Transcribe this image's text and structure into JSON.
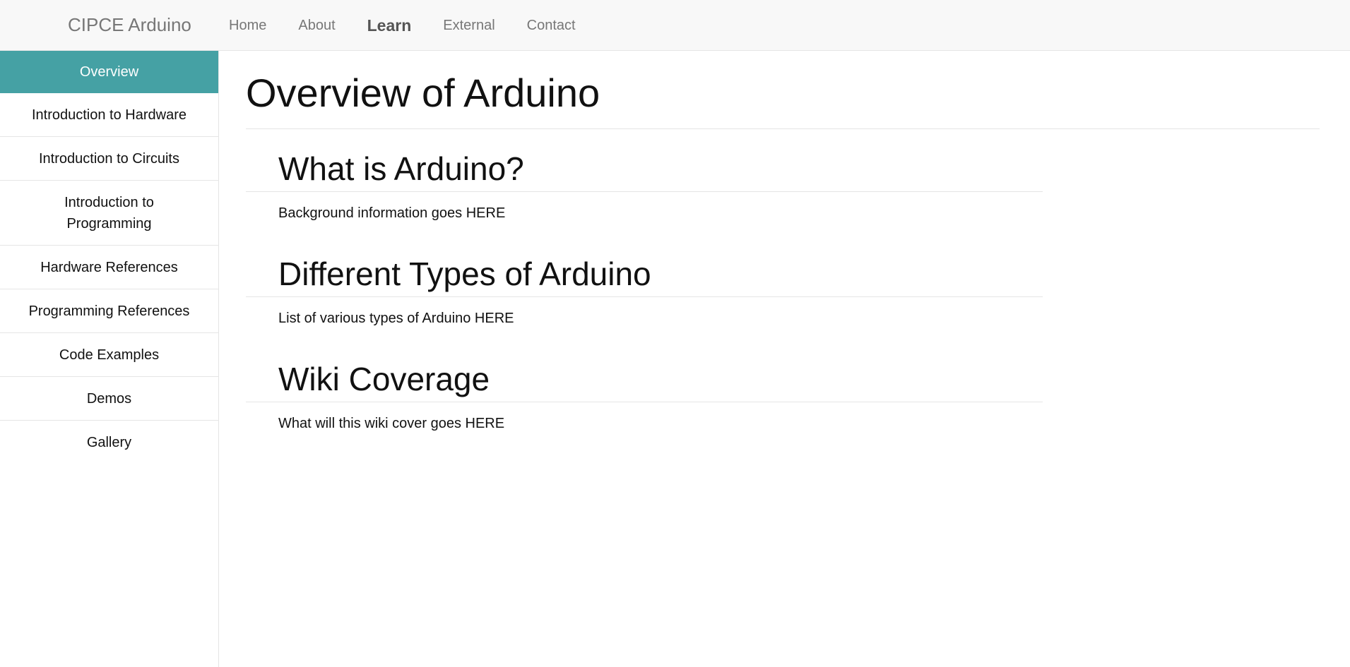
{
  "navbar": {
    "brand": "CIPCE Arduino",
    "links": [
      "Home",
      "About",
      "Learn",
      "External",
      "Contact"
    ],
    "active_link": "Learn"
  },
  "sidebar": {
    "active_item": "Overview",
    "items": [
      "Overview",
      "Introduction to Hardware",
      "Introduction to Circuits",
      "Introduction to Programming",
      "Hardware References",
      "Programming References",
      "Code Examples",
      "Demos",
      "Gallery"
    ]
  },
  "main": {
    "title": "Overview of Arduino",
    "sections": [
      {
        "heading": "What is Arduino?",
        "body": "Background information goes HERE"
      },
      {
        "heading": "Different Types of Arduino",
        "body": "List of various types of Arduino HERE"
      },
      {
        "heading": "Wiki Coverage",
        "body": "What will this wiki cover goes HERE"
      }
    ]
  },
  "colors": {
    "accent": "#45a1a4",
    "navbar_bg": "#f8f8f8",
    "nav_text": "#777777"
  }
}
